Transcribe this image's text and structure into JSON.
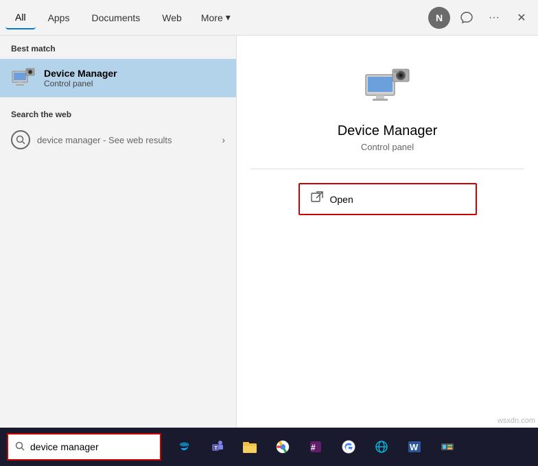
{
  "nav": {
    "tabs": [
      {
        "id": "all",
        "label": "All",
        "active": true
      },
      {
        "id": "apps",
        "label": "Apps"
      },
      {
        "id": "documents",
        "label": "Documents"
      },
      {
        "id": "web",
        "label": "Web"
      },
      {
        "id": "more",
        "label": "More"
      }
    ],
    "avatar_letter": "N",
    "more_icon": "⌄"
  },
  "left": {
    "best_match_label": "Best match",
    "best_match_title": "Device Manager",
    "best_match_subtitle": "Control panel",
    "search_web_label": "Search the web",
    "search_web_text": "device manager",
    "search_web_suffix": " - See web results"
  },
  "right": {
    "app_title": "Device Manager",
    "app_subtitle": "Control panel",
    "open_label": "Open"
  },
  "taskbar": {
    "search_placeholder": "",
    "search_value": "device manager",
    "search_icon": "🔍"
  },
  "watermark": "wsxdn.com"
}
